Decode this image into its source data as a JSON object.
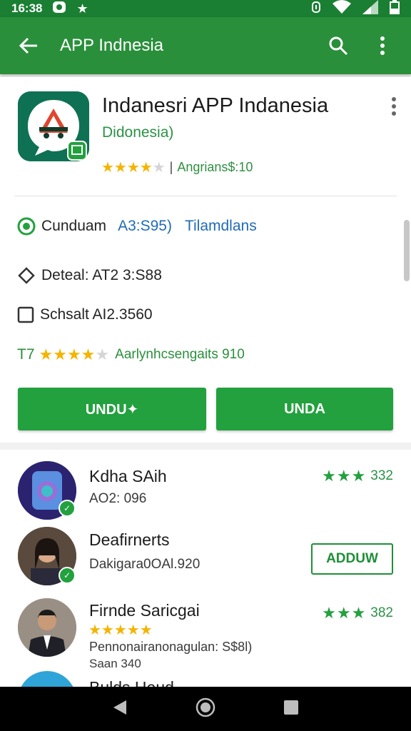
{
  "status_bar": {
    "time": "16:38"
  },
  "app_bar": {
    "title": "APP Indnesia"
  },
  "app": {
    "name": "Indanesri APP Indanesia",
    "developer": "Didonesia)",
    "rating_text": "Angrians$:10",
    "stars": 4
  },
  "details": {
    "download_label": "Cunduam",
    "download_value": "A3:S95)",
    "download_link": "Tilamdlans",
    "detail_text": "Deteal: AT2 3:S88",
    "size_text": "Schsalt AI2.3560",
    "rating_prefix": "T7",
    "rating_text": "Aarlynhcsengaits 910",
    "rating_stars": 4
  },
  "buttons": {
    "primary_left": "UNDU✦",
    "primary_right": "UNDA"
  },
  "colors": {
    "brand_green": "#2a8f3b",
    "status_green": "#1a7f33",
    "button_green": "#22a13e",
    "star_yellow": "#f4b400"
  },
  "list": [
    {
      "name": "Kdha SAih",
      "sub": "AO2: 096",
      "rating": "332"
    },
    {
      "name": "Deafirnerts",
      "sub": "Dakigara0OAl.920",
      "action": "ADDUW"
    },
    {
      "name": "Firnde Saricgai",
      "sub": "Pennonairanonagulan: S$8l)",
      "sub2": "Saan 340",
      "rating": "382"
    },
    {
      "name": "Bulds Heud"
    }
  ]
}
